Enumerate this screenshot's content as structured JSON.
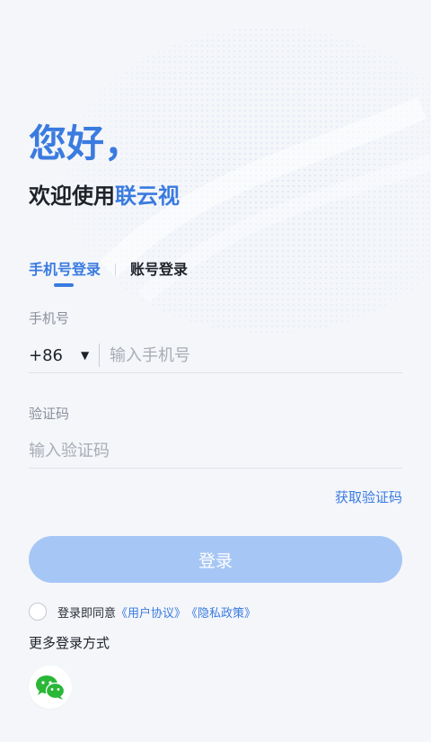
{
  "header": {
    "greeting": "您好，",
    "welcome_prefix": "欢迎使用",
    "brand": "联云视"
  },
  "tabs": [
    {
      "label": "手机号登录",
      "active": true
    },
    {
      "label": "账号登录",
      "active": false
    }
  ],
  "phone": {
    "label": "手机号",
    "country_code": "+86",
    "placeholder": "输入手机号",
    "value": ""
  },
  "code": {
    "label": "验证码",
    "placeholder": "输入验证码",
    "value": "",
    "get_code_label": "获取验证码"
  },
  "login_button": "登录",
  "agreement": {
    "prefix": "登录即同意",
    "user_agreement": "《用户协议》",
    "privacy_policy": "《隐私政策》",
    "checked": false
  },
  "more_login": {
    "title": "更多登录方式",
    "methods": [
      {
        "icon": "wechat-icon"
      }
    ]
  },
  "colors": {
    "accent": "#3a7be0",
    "button_disabled": "#a6c6f5",
    "background": "#f4f6fa",
    "wechat_green": "#2ab737"
  }
}
